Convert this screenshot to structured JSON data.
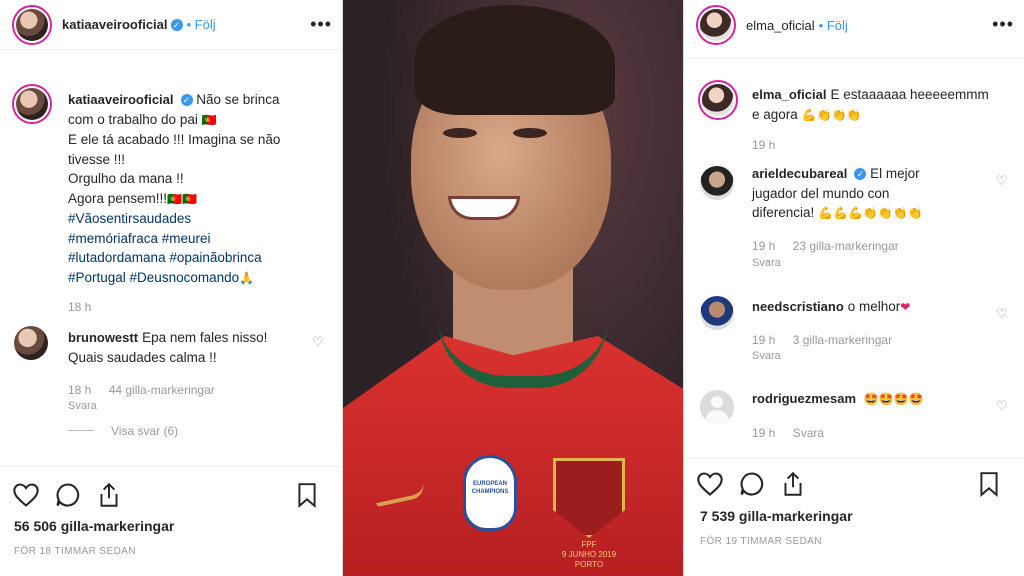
{
  "left_post": {
    "username": "katiaaveirooficial",
    "follow_label": "Följ",
    "caption_lines": [
      "Não se brinca",
      "com o trabalho do pai",
      "E ele tá acabado !!! Imagina se não",
      "tivesse !!!",
      "Orgulho da mana !!",
      "Agora pensem!!!",
      "#Vãosentirsaudades",
      "#memóriafraca #meurei",
      "#lutadordamana #opainãobrinca",
      "#Portugal #Deusnocomando"
    ],
    "caption_time": "18 h",
    "comment": {
      "username": "brunowestt",
      "text_line1": "Epa nem fales nisso!",
      "text_line2": "Quais saudades calma !!",
      "time": "18 h",
      "likes": "44 gilla-markeringar",
      "reply": "Svara",
      "view_replies": "Visa svar (6)"
    },
    "likes_count": "56 506 gilla-markeringar",
    "posted_ago": "FÖR 18 TIMMAR SEDAN"
  },
  "right_post": {
    "username": "elma_oficial",
    "follow_label": "Följ",
    "caption_line1": "E estaaaaaa heeeeemmm",
    "caption_line2": "e agora",
    "caption_time": "19 h",
    "comments": [
      {
        "username": "arieldecubareal",
        "line1": "El mejor",
        "line2": "jugador del mundo con",
        "line3": "diferencia!",
        "time": "19 h",
        "likes": "23 gilla-markeringar",
        "reply": "Svara"
      },
      {
        "username": "needscristiano",
        "text": "o melhor",
        "time": "19 h",
        "likes": "3 gilla-markeringar",
        "reply": "Svara"
      },
      {
        "username": "rodriguezmesam",
        "time": "19 h",
        "reply": "Svara"
      }
    ],
    "likes_count": "7 539 gilla-markeringar",
    "posted_ago": "FÖR 19 TIMMAR SEDAN"
  },
  "center_photo": {
    "badge_text": "EUROPEAN CHAMPIONS",
    "crest_caption_line1": "FPF",
    "crest_caption_line2": "9 JUNHO 2019",
    "crest_caption_line3": "PORTO"
  },
  "colors": {
    "link_blue": "#3897f0",
    "hashtag": "#003569",
    "jersey_red": "#c7282a",
    "collar_green": "#1f5f3a"
  }
}
